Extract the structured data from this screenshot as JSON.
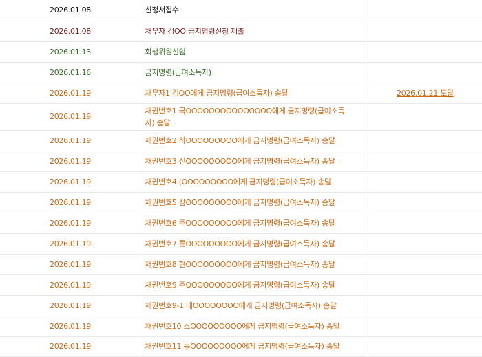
{
  "colors": {
    "black": "#111111",
    "red": "#7a1d1d",
    "green": "#3a6b2a",
    "orange": "#cc6a13"
  },
  "rows": [
    {
      "date": "2026.01.08",
      "content": "신청서접수",
      "result": "",
      "status": "black"
    },
    {
      "date": "2026.01.08",
      "content": "채무자 김OO 금지명령신청 제출",
      "result": "",
      "status": "red"
    },
    {
      "date": "2026.01.13",
      "content": "회생위원선임",
      "result": "",
      "status": "green"
    },
    {
      "date": "2026.01.16",
      "content": "금지명령(급여소득자)",
      "result": "",
      "status": "green"
    },
    {
      "date": "2026.01.19",
      "content": "채무자1 김OO에게 금지명령(급여소득자) 송달",
      "result": "2026.01.21 도달",
      "status": "orange"
    },
    {
      "date": "2026.01.19",
      "content": "채권번호1 국OOOOOOOOOOOOOOO에게 금지명령(급여소득자) 송달",
      "result": "",
      "status": "orange"
    },
    {
      "date": "2026.01.19",
      "content": "채권번호2 하OOOOOOOOO에게 금지명령(급여소득자) 송달",
      "result": "",
      "status": "orange"
    },
    {
      "date": "2026.01.19",
      "content": "채권번호3 신OOOOOOOOO에게 금지명령(급여소득자) 송달",
      "result": "",
      "status": "orange"
    },
    {
      "date": "2026.01.19",
      "content": "채권번호4 (OOOOOOOOO에게 금지명령(급여소득자) 송달",
      "result": "",
      "status": "orange"
    },
    {
      "date": "2026.01.19",
      "content": "채권번호5 삼OOOOOOOOO에게 금지명령(급여소득자) 송달",
      "result": "",
      "status": "orange"
    },
    {
      "date": "2026.01.19",
      "content": "채권번호6 주OOOOOOOOO에게 금지명령(급여소득자) 송달",
      "result": "",
      "status": "orange"
    },
    {
      "date": "2026.01.19",
      "content": "채권번호7 롯OOOOOOOOO에게 금지명령(급여소득자) 송달",
      "result": "",
      "status": "orange"
    },
    {
      "date": "2026.01.19",
      "content": "채권번호8 현OOOOOOOOO에게 금지명령(급여소득자) 송달",
      "result": "",
      "status": "orange"
    },
    {
      "date": "2026.01.19",
      "content": "채권번호9 주OOOOOOOOO에게 금지명령(급여소득자) 송달",
      "result": "",
      "status": "orange"
    },
    {
      "date": "2026.01.19",
      "content": "채권번호9-1 대OOOOOOOO에게 금지명령(급여소득자) 송달",
      "result": "",
      "status": "orange"
    },
    {
      "date": "2026.01.19",
      "content": "채권번호10 소OOOOOOOOO에게 금지명령(급여소득자) 송달",
      "result": "",
      "status": "orange"
    },
    {
      "date": "2026.01.19",
      "content": "채권번호11 농OOOOOOOOO에게 금지명령(급여소득자) 송달",
      "result": "",
      "status": "orange"
    }
  ]
}
